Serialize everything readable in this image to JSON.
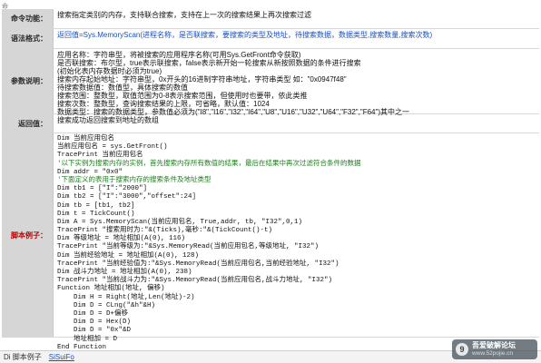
{
  "rows": [
    {
      "label": "命令功能：",
      "lines": [
        {
          "text": "搜索指定类别的内存，支持联合搜索，支持在上一次的搜索结果上再次搜索过滤",
          "cls": ""
        }
      ]
    },
    {
      "label": "语法格式：",
      "lines": [
        {
          "text": "返回值=Sys.MemoryScan(进程名称，是否联搜索，要搜索的类型及地址，待搜索数据，数据类型,搜索数量,搜索次数)",
          "cls": "blue"
        }
      ]
    },
    {
      "label": "参数说明：",
      "lines": [
        {
          "text": "应用名称：字符串型，将被搜索的应用程序名称(可用Sys.GetFront命令获取)",
          "cls": ""
        },
        {
          "text": "是否联搜索：布尔型，true表示联搜索，false表示新开始一轮搜索从新按照数据的条件进行搜索",
          "cls": ""
        },
        {
          "text": "(初始化表内存数据时必须为true)",
          "cls": ""
        },
        {
          "text": "搜索内存起始地址：字符串型，0x开头的16进制字符串地址，字符串类型 如：\"0x0947f48\"",
          "cls": ""
        },
        {
          "text": "待搜索数据值：数值型，具体搜索的数值",
          "cls": ""
        },
        {
          "text": "搜索范围：整数型，取值范围为0-8表示搜索范围，但使用时也要带，依此类推",
          "cls": ""
        },
        {
          "text": "搜索次数：整数型，查询搜索结果的上限，可省略，默认值：1024",
          "cls": ""
        },
        {
          "text": "数据类型：搜索的数据类型，参数值必须为(\"I8\",\"I16\",\"I32\",\"I64\",\"U8\",\"U16\",\"U32\",\"U64\",\"F32\",\"F64\")其中之一",
          "cls": ""
        }
      ]
    },
    {
      "label": "返回值：",
      "lines": [
        {
          "text": "搜索成功返回搜索到地址的数组",
          "cls": ""
        }
      ]
    },
    {
      "label": "脚本例子：",
      "lines": [
        {
          "text": "Dim 当前应用包名",
          "cls": ""
        },
        {
          "text": "当前应用包名 = sys.GetFront()",
          "cls": ""
        },
        {
          "text": "TracePrint 当前应用包名",
          "cls": ""
        },
        {
          "text": "'以下实例为搜索内存的实例，首先搜索内存所有数值的结果，最后在结果中再次过滤符合条件的数据",
          "cls": "green"
        },
        {
          "text": "Dim addr = \"0x0\"",
          "cls": ""
        },
        {
          "text": "'下面定义的表用于搜索内存的搜索条件及地址类型",
          "cls": "green"
        },
        {
          "text": "Dim tb1 = [\"I\":\"2000\"]",
          "cls": ""
        },
        {
          "text": "Dim tb2 = [\"I\":\"3000\",\"offset\":24]",
          "cls": ""
        },
        {
          "text": "Dim tb = [tb1, tb2]",
          "cls": ""
        },
        {
          "text": "Dim t = TickCount()",
          "cls": ""
        },
        {
          "text": "Dim A = Sys.MemoryScan(当前应用包名, True,addr, tb, \"I32\",0,1)",
          "cls": ""
        },
        {
          "text": "TracePrint \"搜索用时为:\"&(Ticks),毫秒:\"&(TickCount()-t)",
          "cls": ""
        },
        {
          "text": "Dim 等级地址 = 地址相加(A(0), 116)",
          "cls": ""
        },
        {
          "text": "TracePrint \"当前等级为:\"&Sys.MemoryRead(当前应用包名,等级地址, \"I32\")",
          "cls": ""
        },
        {
          "text": "Dim 当前经验地址 = 地址相加(A(0), 128)",
          "cls": ""
        },
        {
          "text": "TracePrint \"当前经验值为:\"&Sys.MemoryRead(当前应用包名,当前经验地址, \"I32\")",
          "cls": ""
        },
        {
          "text": "Dim 战斗力地址 = 地址相加(A(0), 238)",
          "cls": ""
        },
        {
          "text": "TracePrint \"当前战斗力为:\"&Sys.MemoryRead(当前应用包名,战斗力地址, \"I32\")",
          "cls": ""
        },
        {
          "text": "Function 地址相加(地址, 偏移)",
          "cls": ""
        },
        {
          "text": "    Dim H = Right(地址,Len(地址)-2)",
          "cls": ""
        },
        {
          "text": "    Dim D = CLng(\"&h\"&H)",
          "cls": ""
        },
        {
          "text": "    Dim D = D+偏移",
          "cls": ""
        },
        {
          "text": "    Dim D = Hex(D)",
          "cls": ""
        },
        {
          "text": "    Dim D = \"0x\"&D",
          "cls": ""
        },
        {
          "text": "    地址相加 = D",
          "cls": ""
        },
        {
          "text": "End Function",
          "cls": ""
        }
      ]
    }
  ],
  "footer": {
    "tab": "Di  脚本例子",
    "link": "SiSuiFo"
  },
  "watermark": {
    "logo": "9",
    "line1": "吾爱破解论坛",
    "line2": "www.52pojie.cn"
  },
  "corner": "命"
}
